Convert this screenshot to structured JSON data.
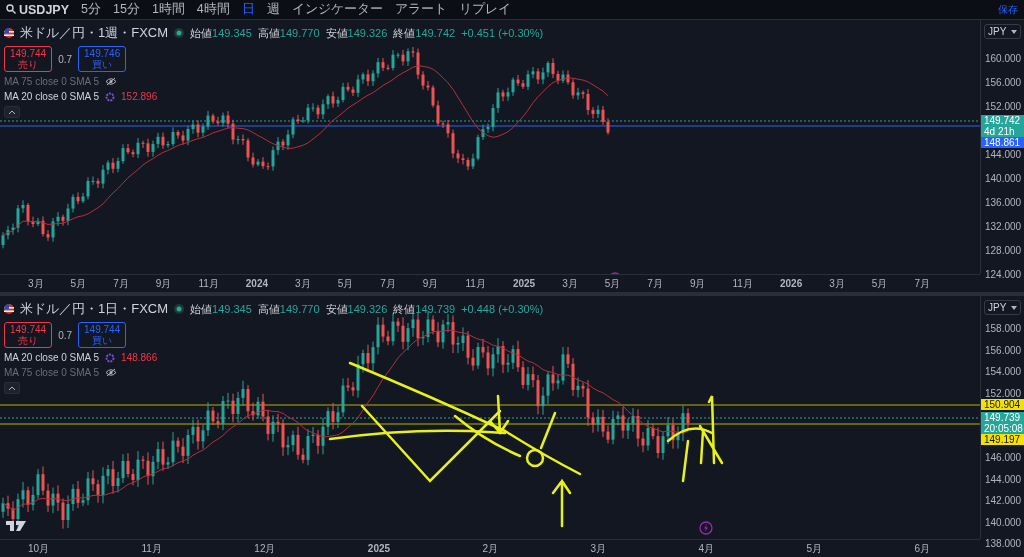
{
  "toolbar": {
    "symbol": "USDJPY",
    "intervals": [
      {
        "label": "5分",
        "selected": false
      },
      {
        "label": "15分",
        "selected": false
      },
      {
        "label": "1時間",
        "selected": false
      },
      {
        "label": "4時間",
        "selected": false
      },
      {
        "label": "日",
        "selected": true
      },
      {
        "label": "週",
        "selected": false
      }
    ],
    "indicators": "インジケーター",
    "alert": "アラート",
    "replay": "リプレイ",
    "save": "保存"
  },
  "panes": [
    {
      "title": "米ドル／円・1週・FXCM",
      "ohlc": [
        {
          "label": "始値",
          "value": "149.345"
        },
        {
          "label": "高値",
          "value": "149.770"
        },
        {
          "label": "安値",
          "value": "149.326"
        },
        {
          "label": "終値",
          "value": "149.742"
        }
      ],
      "change": "+0.451 (+0.30%)",
      "sell": {
        "price": "149.744",
        "label": "売り"
      },
      "spread": "0.7",
      "buy": {
        "price": "149.746",
        "label": "買い"
      },
      "indicators": [
        {
          "label": "MA 75 close 0 SMA 5",
          "visible": false
        },
        {
          "label": "MA 20 close 0 SMA 5",
          "visible": true,
          "value": "152.896"
        }
      ],
      "currency": "JPY",
      "price_ticks": [
        "160.000",
        "156.000",
        "152.000",
        "144.000",
        "140.000",
        "136.000",
        "132.000",
        "128.000",
        "124.000"
      ],
      "price_labels": [
        {
          "text": "149.742",
          "sub": "4d 21h",
          "kind": "last"
        },
        {
          "text": "148.861",
          "kind": "ma"
        }
      ],
      "time_ticks": [
        {
          "text": "3月",
          "kind": "month"
        },
        {
          "text": "5月",
          "kind": "month"
        },
        {
          "text": "7月",
          "kind": "month"
        },
        {
          "text": "9月",
          "kind": "month"
        },
        {
          "text": "11月",
          "kind": "month"
        },
        {
          "text": "2024",
          "kind": "year"
        },
        {
          "text": "3月",
          "kind": "month"
        },
        {
          "text": "5月",
          "kind": "month"
        },
        {
          "text": "7月",
          "kind": "month"
        },
        {
          "text": "9月",
          "kind": "month"
        },
        {
          "text": "11月",
          "kind": "month"
        },
        {
          "text": "2025",
          "kind": "year"
        },
        {
          "text": "3月",
          "kind": "month"
        },
        {
          "text": "5月",
          "kind": "month"
        },
        {
          "text": "7月",
          "kind": "month"
        },
        {
          "text": "9月",
          "kind": "month"
        },
        {
          "text": "11月",
          "kind": "month"
        },
        {
          "text": "2026",
          "kind": "year"
        },
        {
          "text": "3月",
          "kind": "month"
        },
        {
          "text": "5月",
          "kind": "month"
        },
        {
          "text": "7月",
          "kind": "month"
        }
      ]
    },
    {
      "title": "米ドル／円・1日・FXCM",
      "ohlc": [
        {
          "label": "始値",
          "value": "149.345"
        },
        {
          "label": "高値",
          "value": "149.770"
        },
        {
          "label": "安値",
          "value": "149.326"
        },
        {
          "label": "終値",
          "value": "149.739"
        }
      ],
      "change": "+0.448 (+0.30%)",
      "sell": {
        "price": "149.744",
        "label": "売り"
      },
      "spread": "0.7",
      "buy": {
        "price": "149.744",
        "label": "買い"
      },
      "indicators": [
        {
          "label": "MA 20 close 0 SMA 5",
          "visible": true,
          "value": "148.866"
        },
        {
          "label": "MA 75 close 0 SMA 5",
          "visible": false
        }
      ],
      "currency": "JPY",
      "price_ticks": [
        "158.000",
        "156.000",
        "154.000",
        "152.000",
        "146.000",
        "144.000",
        "142.000",
        "140.000",
        "138.000"
      ],
      "price_labels": [
        {
          "text": "150.904",
          "kind": "level"
        },
        {
          "text": "149.739",
          "sub": "20:05:08",
          "kind": "last"
        },
        {
          "text": "149.197",
          "kind": "level"
        }
      ],
      "time_ticks": [
        {
          "text": "10月",
          "kind": "month"
        },
        {
          "text": "11月",
          "kind": "month"
        },
        {
          "text": "12月",
          "kind": "month"
        },
        {
          "text": "2025",
          "kind": "year"
        },
        {
          "text": "2月",
          "kind": "month"
        },
        {
          "text": "3月",
          "kind": "month"
        },
        {
          "text": "4月",
          "kind": "month"
        },
        {
          "text": "5月",
          "kind": "month"
        },
        {
          "text": "6月",
          "kind": "month"
        }
      ]
    }
  ]
}
